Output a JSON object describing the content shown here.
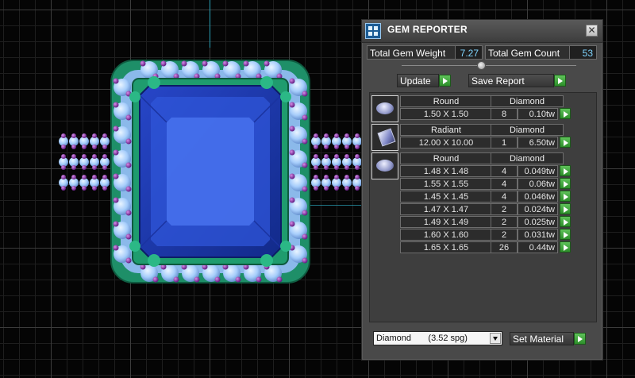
{
  "panel": {
    "title": "GEM REPORTER",
    "close_glyph": "✕",
    "icon": "gem-reporter-icon",
    "total_weight_label": "Total Gem Weight",
    "total_weight_value": "7.27",
    "total_count_label": "Total Gem Count",
    "total_count_value": "53",
    "update_label": "Update",
    "save_report_label": "Save Report",
    "set_material_label": "Set Material",
    "material_select": {
      "selected": "Diamond       (3.52 spg)"
    }
  },
  "groups": [
    {
      "icon": "round-gem-icon",
      "shape": "Round",
      "material": "Diamond",
      "rows": [
        {
          "size": "1.50 X 1.50",
          "count": "8",
          "weight": "0.10tw"
        }
      ]
    },
    {
      "icon": "radiant-gem-icon",
      "shape": "Radiant",
      "material": "Diamond",
      "rows": [
        {
          "size": "12.00 X 10.00",
          "count": "1",
          "weight": "6.50tw"
        }
      ]
    },
    {
      "icon": "round-gem-icon",
      "shape": "Round",
      "material": "Diamond",
      "rows": [
        {
          "size": "1.48 X 1.48",
          "count": "4",
          "weight": "0.049tw"
        },
        {
          "size": "1.55 X 1.55",
          "count": "4",
          "weight": "0.06tw"
        },
        {
          "size": "1.45 X 1.45",
          "count": "4",
          "weight": "0.046tw"
        },
        {
          "size": "1.47 X 1.47",
          "count": "2",
          "weight": "0.024tw"
        },
        {
          "size": "1.49 X 1.49",
          "count": "2",
          "weight": "0.025tw"
        },
        {
          "size": "1.60 X 1.60",
          "count": "2",
          "weight": "0.031tw"
        },
        {
          "size": "1.65 X 1.65",
          "count": "26",
          "weight": "0.44tw"
        }
      ]
    }
  ],
  "colors": {
    "panel_bg": "#494949",
    "value_text": "#7fd5ff",
    "go_button": "#3fa83a",
    "sapphire": "#1f3fb8",
    "halo_diamond": "#9fc9ff",
    "metal_prong": "#7b1fa2",
    "setting_green": "#1f9c6e"
  }
}
